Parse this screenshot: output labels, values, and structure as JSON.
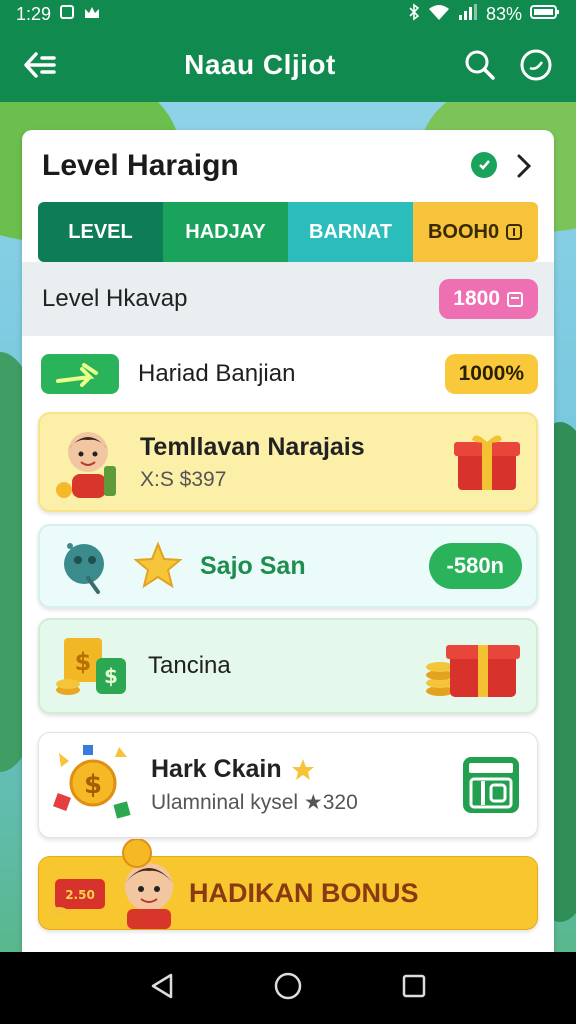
{
  "status": {
    "time": "1:29",
    "battery": "83%"
  },
  "header": {
    "title": "Naau Cljiot"
  },
  "card": {
    "title": "Level Haraign"
  },
  "tabs": [
    {
      "label": "LEVEL"
    },
    {
      "label": "HADJAY"
    },
    {
      "label": "BARNAT"
    },
    {
      "label": "BOOH0"
    }
  ],
  "level_row": {
    "label": "Level Hkavap",
    "badge": "1800"
  },
  "plain_row": {
    "label": "Hariad Banjian",
    "badge": "1000%"
  },
  "rows": [
    {
      "title": "Temllavan Narajais",
      "sub": "X:S $397"
    },
    {
      "title": "Sajo San",
      "badge": "-580n"
    },
    {
      "title": "Tancina"
    },
    {
      "title": "Hark Ckain",
      "sub": "Ulamninal kysel ★320"
    }
  ],
  "bonus": {
    "label": "HADIKAN BONUS",
    "chip": "2.50"
  },
  "colors": {
    "primary_green": "#108a4f",
    "accent_yellow": "#f9c93b",
    "accent_pink": "#ef6fb3"
  }
}
